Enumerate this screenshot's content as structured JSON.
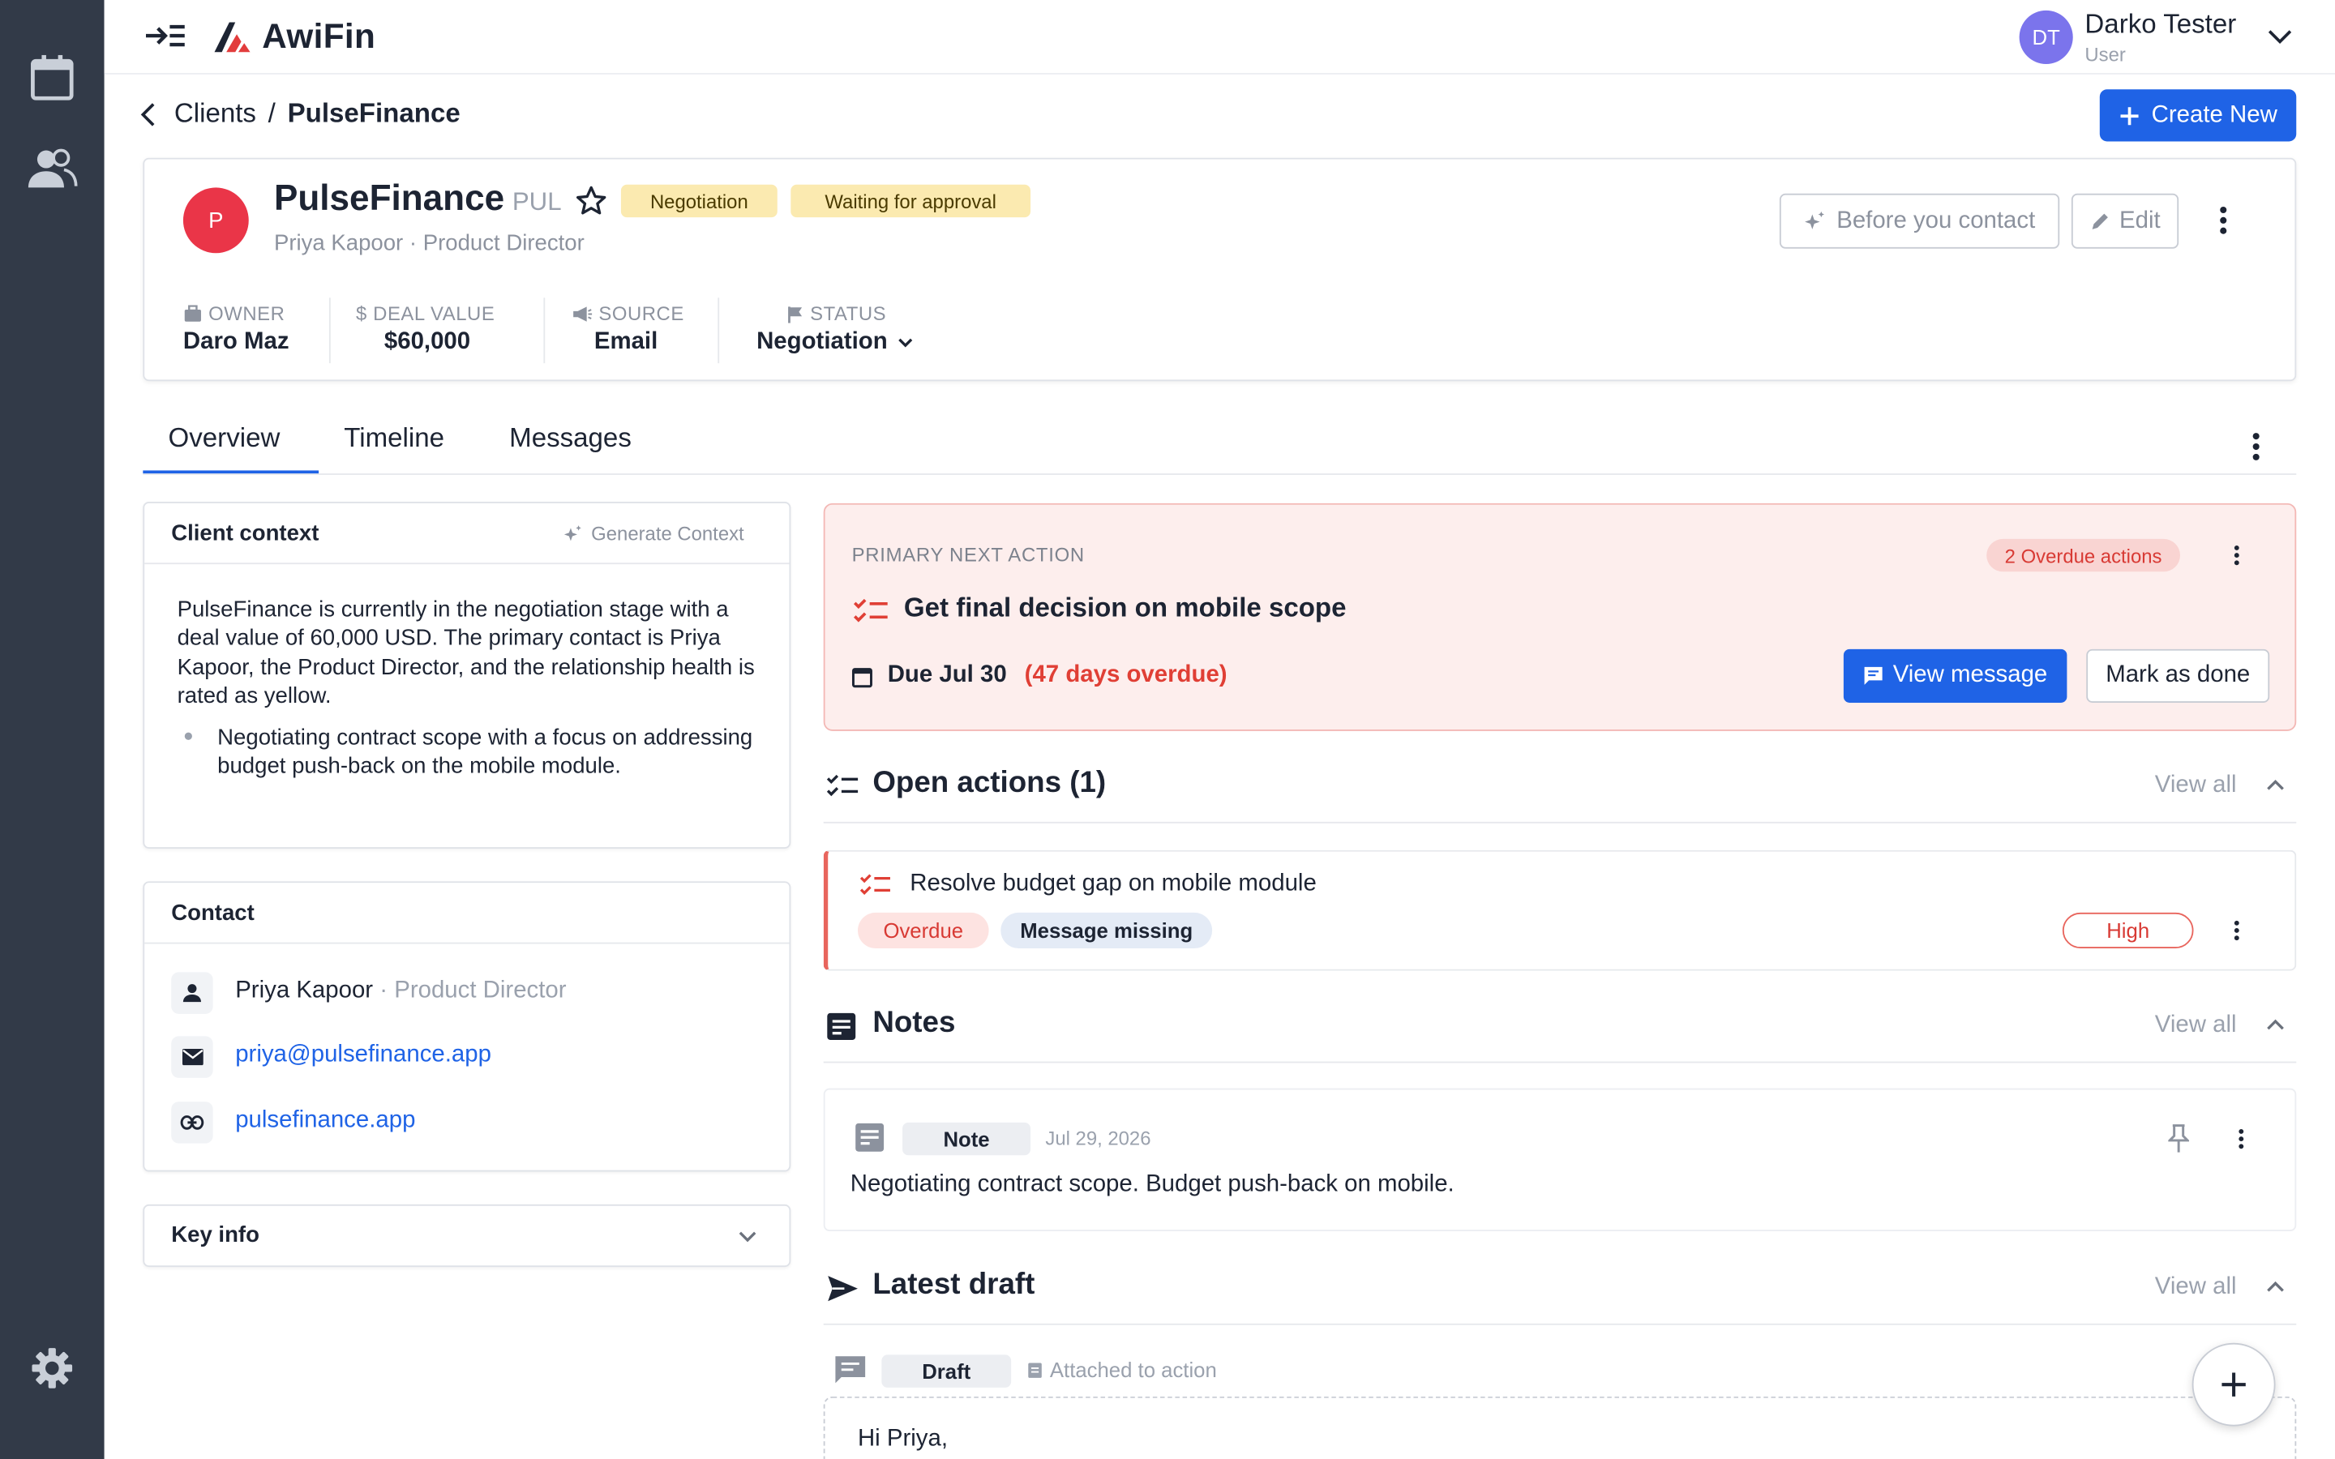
{
  "app": {
    "brand": "AwiFin"
  },
  "colors": {
    "primary": "#1f63e6",
    "sidebar": "#323a48",
    "danger": "#e03f35",
    "badge_yellow": "#fbeab0",
    "avatar_purple": "#7b74ec",
    "client_red": "#ea3548"
  },
  "sidebar": {
    "items": [
      {
        "icon": "calendar-icon"
      },
      {
        "icon": "users-icon"
      }
    ],
    "footer_icon": "settings-gear-icon"
  },
  "user": {
    "initials": "DT",
    "name": "Darko Tester",
    "role": "User"
  },
  "breadcrumb": {
    "parent": "Clients",
    "separator": "/",
    "current": "PulseFinance"
  },
  "create_button": {
    "label": "Create New"
  },
  "client": {
    "initial": "P",
    "name": "PulseFinance",
    "code": "PUL",
    "badges": [
      "Negotiation",
      "Waiting for approval"
    ],
    "subtitle": "Priya Kapoor · Product Director",
    "actions": {
      "before_contact": "Before you contact",
      "edit": "Edit"
    },
    "meta": {
      "owner_label": "OWNER",
      "owner": "Daro Maz",
      "deal_label": "DEAL VALUE",
      "deal": "$60,000",
      "source_label": "SOURCE",
      "source": "Email",
      "status_label": "STATUS",
      "status": "Negotiation"
    }
  },
  "tabs": [
    {
      "label": "Overview",
      "active": true
    },
    {
      "label": "Timeline"
    },
    {
      "label": "Messages"
    }
  ],
  "client_context": {
    "title": "Client context",
    "generate_label": "Generate Context",
    "paragraph": "PulseFinance is currently in the negotiation stage with a deal value of 60,000 USD. The primary contact is Priya Kapoor, the Product Director, and the relationship health is rated as yellow.",
    "bullet": "Negotiating contract scope with a focus on addressing budget push-back on the mobile module."
  },
  "contact": {
    "title": "Contact",
    "name": "Priya Kapoor",
    "role": "· Product Director",
    "email": "priya@pulsefinance.app",
    "website": "pulsefinance.app"
  },
  "key_info": {
    "title": "Key info"
  },
  "primary_action": {
    "label": "PRIMARY NEXT ACTION",
    "overdue_chip": "2 Overdue actions",
    "title": "Get final decision on mobile scope",
    "due": "Due Jul 30",
    "overdue": "(47 days overdue)",
    "view_message": "View message",
    "mark_done": "Mark as done"
  },
  "open_actions": {
    "title": "Open actions (1)",
    "view_all": "View all",
    "items": [
      {
        "title": "Resolve budget gap on mobile module",
        "status": "Overdue",
        "tag": "Message missing",
        "priority": "High"
      }
    ]
  },
  "notes": {
    "title": "Notes",
    "view_all": "View all",
    "items": [
      {
        "type": "Note",
        "date": "Jul 29, 2026",
        "text": "Negotiating contract scope. Budget push-back on mobile."
      }
    ]
  },
  "latest_draft": {
    "title": "Latest draft",
    "view_all": "View all",
    "chip": "Draft",
    "attached": "Attached to action",
    "text": "Hi Priya,"
  }
}
